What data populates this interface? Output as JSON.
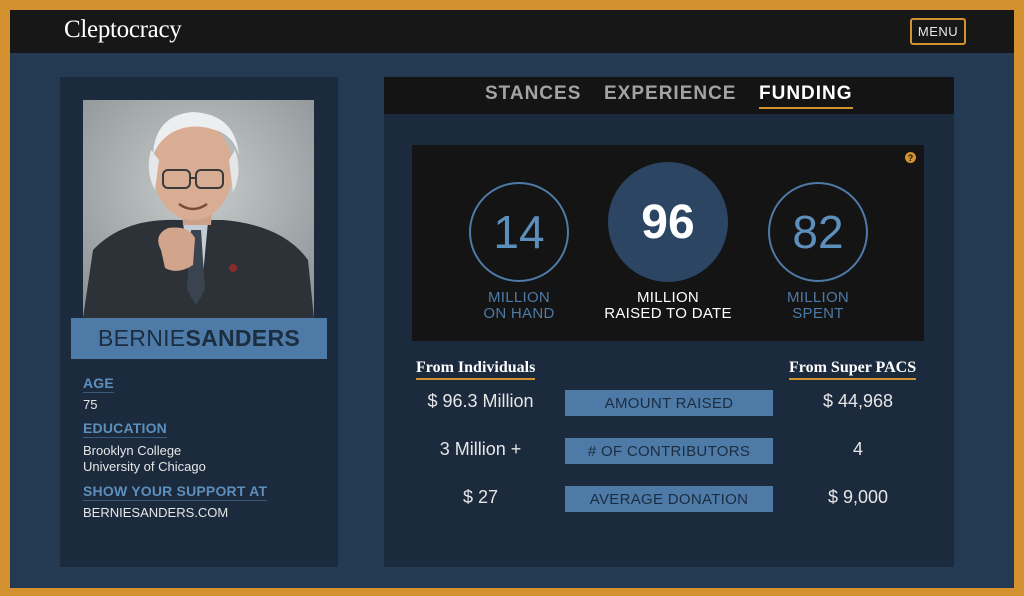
{
  "header": {
    "logo": "Cleptocracy",
    "menu_label": "MENU"
  },
  "candidate": {
    "first_name": "BERNIE",
    "last_name": "SANDERS",
    "age_label": "AGE",
    "age": "75",
    "education_label": "EDUCATION",
    "education": [
      "Brooklyn College",
      "University of Chicago"
    ],
    "support_label": "SHOW YOUR SUPPORT AT",
    "support_site": "BERNIESANDERS.COM"
  },
  "tabs": [
    {
      "label": "STANCES",
      "active": false
    },
    {
      "label": "EXPERIENCE",
      "active": false
    },
    {
      "label": "FUNDING",
      "active": true
    }
  ],
  "funding": {
    "help_icon": "?",
    "stats": [
      {
        "value": "14",
        "line1": "MILLION",
        "line2": "ON HAND"
      },
      {
        "value": "96",
        "line1": "MILLION",
        "line2": "RAISED TO DATE"
      },
      {
        "value": "82",
        "line1": "MILLION",
        "line2": "SPENT"
      }
    ],
    "individuals_heading": "From Individuals",
    "superpacs_heading": "From Super PACS",
    "rows": [
      {
        "label": "AMOUNT RAISED",
        "individuals": "$ 96.3 Million",
        "superpacs": "$ 44,968"
      },
      {
        "label": "# OF CONTRIBUTORS",
        "individuals": "3 Million +",
        "superpacs": "4"
      },
      {
        "label": "AVERAGE DONATION",
        "individuals": "$ 27",
        "superpacs": "$ 9,000"
      }
    ]
  },
  "colors": {
    "accent": "#d4912f",
    "background": "#243a52",
    "card": "#1b2a3c",
    "blue": "#4d7aa6",
    "dark": "#141414"
  }
}
